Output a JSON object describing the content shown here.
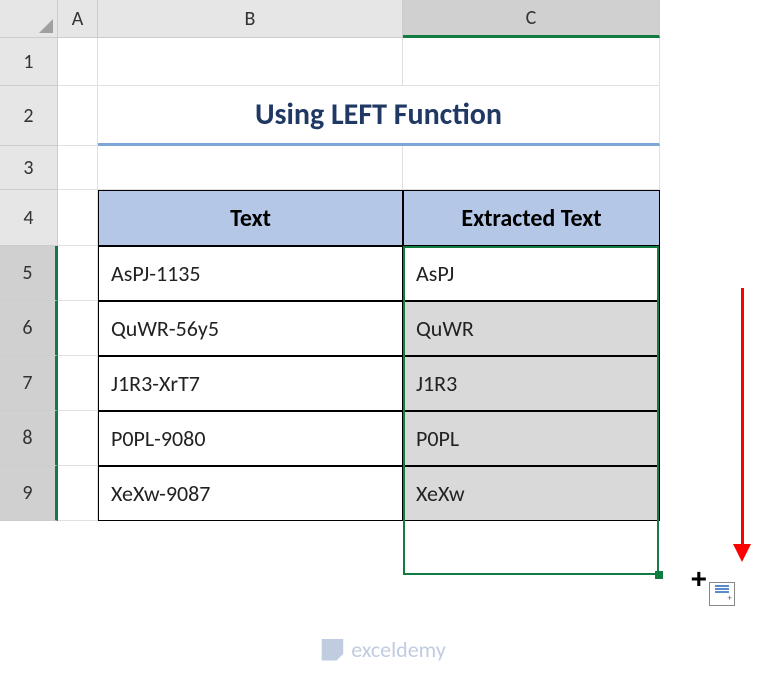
{
  "columns": {
    "a": "A",
    "b": "B",
    "c": "C"
  },
  "rows": {
    "r1": "1",
    "r2": "2",
    "r3": "3",
    "r4": "4",
    "r5": "5",
    "r6": "6",
    "r7": "7",
    "r8": "8",
    "r9": "9"
  },
  "title": "Using LEFT Function",
  "table": {
    "headers": {
      "text": "Text",
      "extracted": "Extracted Text"
    },
    "rows": [
      {
        "text": "AsPJ-1135",
        "extracted": "AsPJ"
      },
      {
        "text": "QuWR-56y5",
        "extracted": "QuWR"
      },
      {
        "text": "J1R3-XrT7",
        "extracted": "J1R3"
      },
      {
        "text": "P0PL-9080",
        "extracted": "P0PL"
      },
      {
        "text": "XeXw-9087",
        "extracted": "XeXw"
      }
    ]
  },
  "watermark": "exceldemy"
}
